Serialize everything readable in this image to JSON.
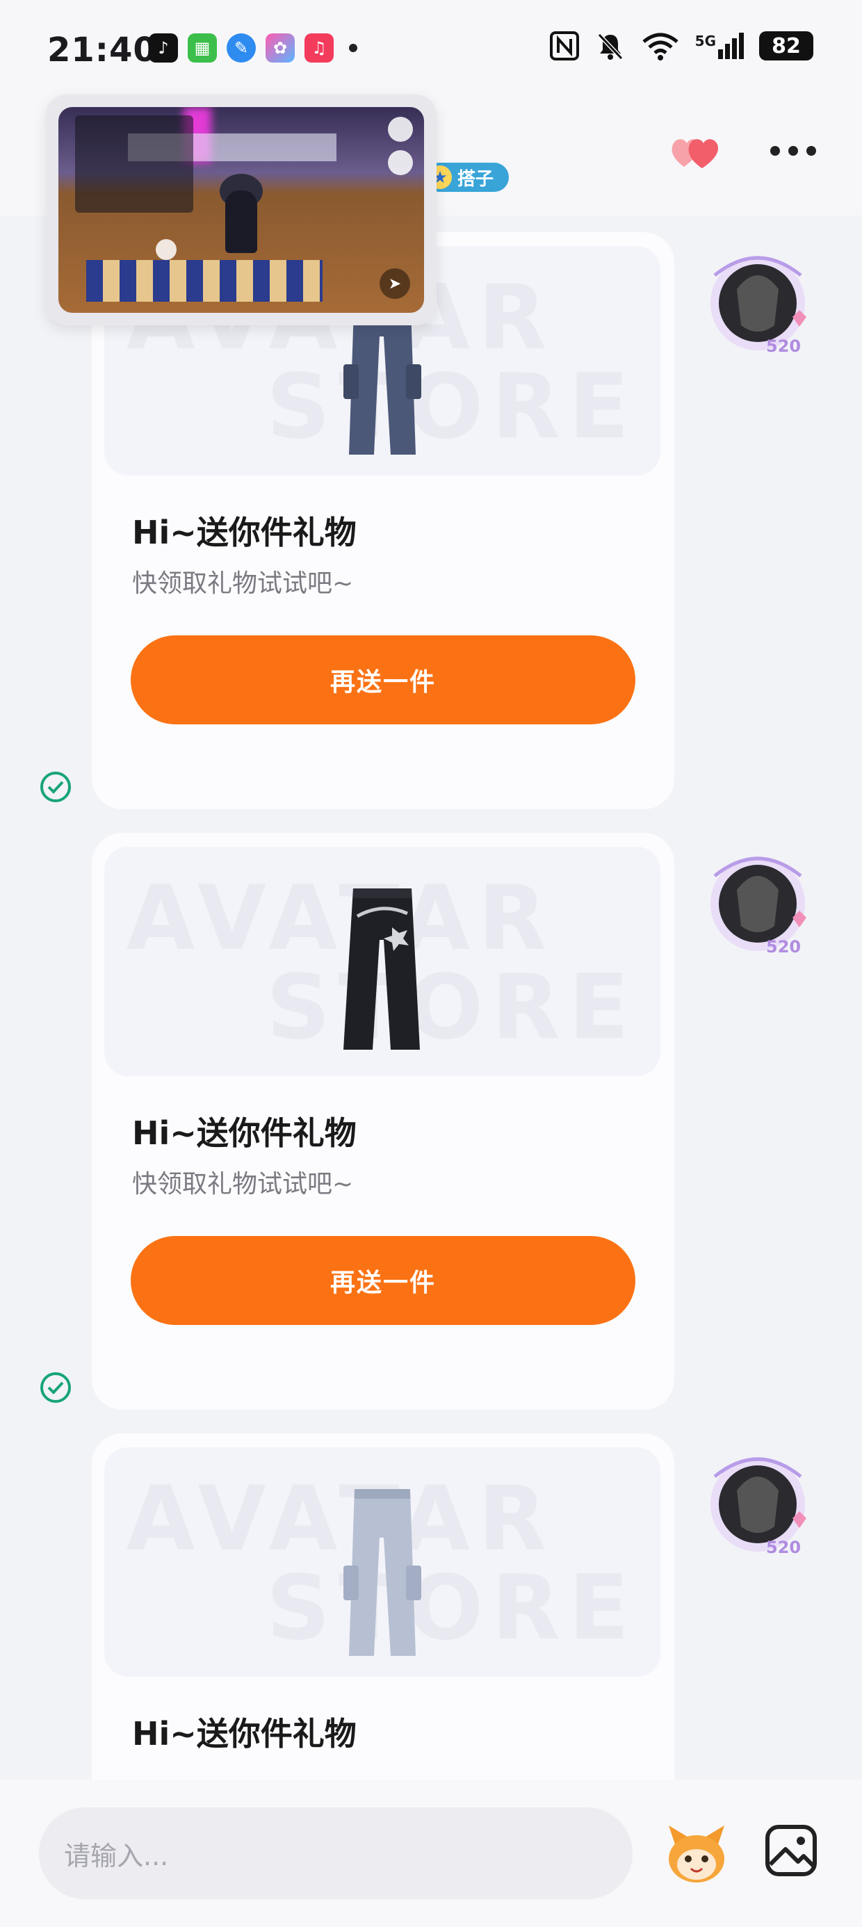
{
  "status_bar": {
    "time": "21:40",
    "app_icons": [
      "tiktok-icon",
      "wechat-icon",
      "feather-icon",
      "butterfly-icon",
      "music-icon"
    ],
    "network": "5G",
    "battery": "82"
  },
  "header": {
    "tag_label": "搭子"
  },
  "cards": [
    {
      "item_icon": "cargo-pants-blue-icon",
      "title": "Hi~送你件礼物",
      "subtitle": "快领取礼物试试吧~",
      "button_label": "再送一件",
      "sent": true
    },
    {
      "item_icon": "jeans-black-icon",
      "title": "Hi~送你件礼物",
      "subtitle": "快领取礼物试试吧~",
      "button_label": "再送一件",
      "sent": true
    },
    {
      "item_icon": "cargo-pants-light-icon",
      "title": "Hi~送你件礼物"
    }
  ],
  "watermark": {
    "line1": "AVATAR",
    "line2": "STORE"
  },
  "avatar_badge": "520",
  "input": {
    "placeholder": "请输入..."
  },
  "colors": {
    "accent": "#fb7214",
    "tag": "#39a4d8",
    "check": "#17a37a",
    "background": "#f2f3f7"
  }
}
